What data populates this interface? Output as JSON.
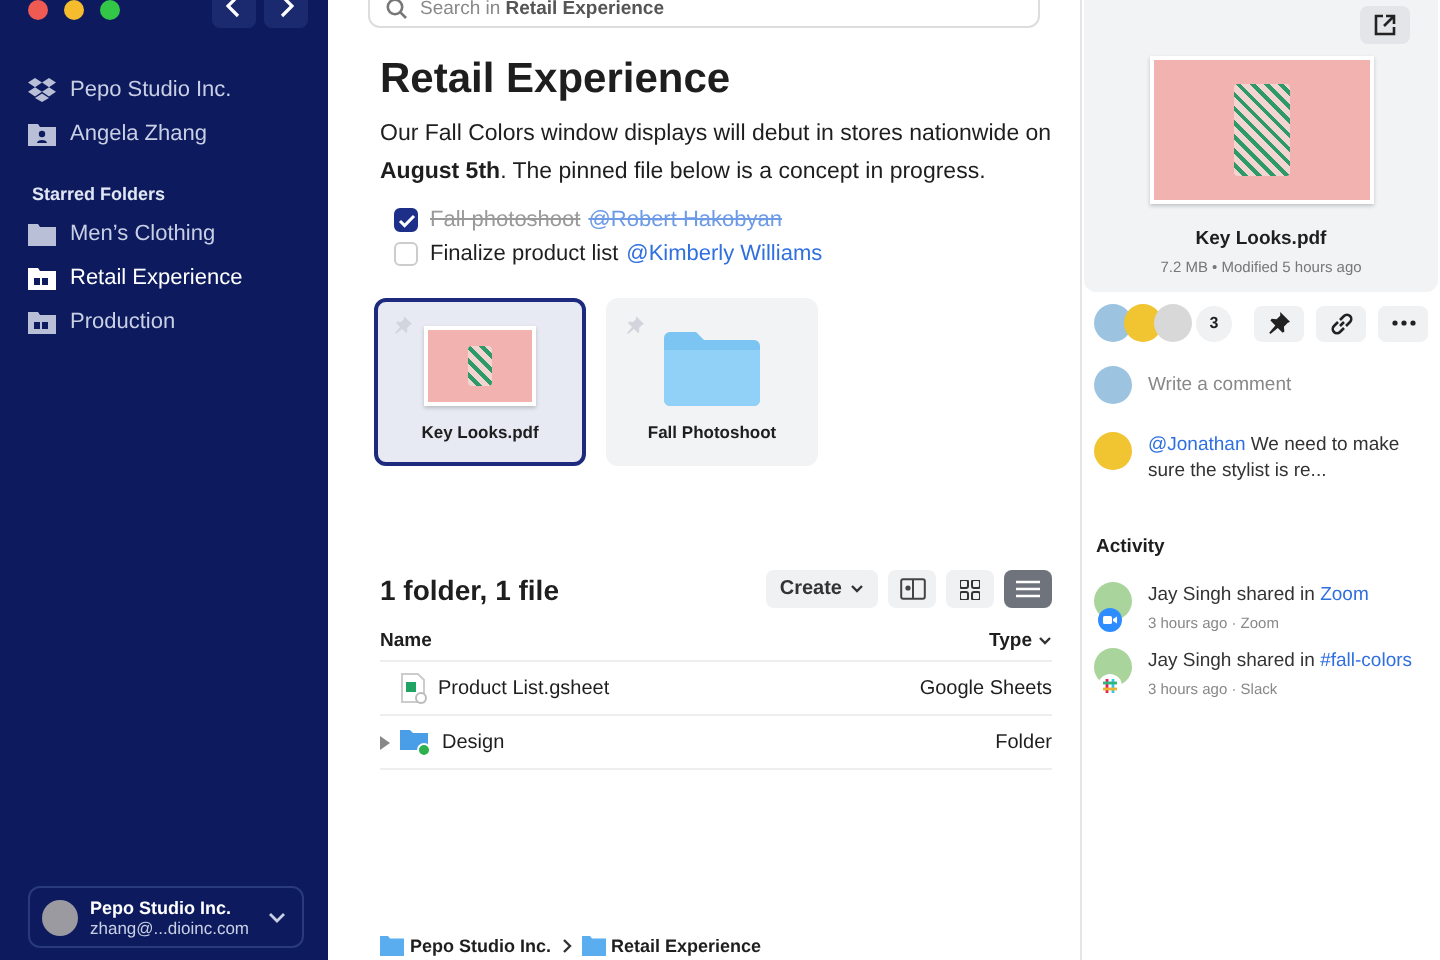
{
  "sidebar": {
    "accounts": [
      {
        "kind": "team",
        "label": "Pepo Studio Inc."
      },
      {
        "kind": "personal",
        "label": "Angela Zhang"
      }
    ],
    "starred_heading": "Starred Folders",
    "folders": [
      {
        "label": "Men’s Clothing",
        "kind": "plain",
        "selected": false
      },
      {
        "label": "Retail Experience",
        "kind": "shared",
        "selected": true
      },
      {
        "label": "Production",
        "kind": "shared",
        "selected": false
      }
    ],
    "account_card": {
      "name": "Pepo Studio Inc.",
      "email": "zhang@...dioinc.com"
    }
  },
  "search": {
    "placeholder": "Search in **Retail Experience**"
  },
  "page": {
    "title": "Retail Experience",
    "description": "Our Fall Colors window displays will debut in stores nationwide on **August 5th**. The pinned file below is a concept in progress.",
    "tasks": [
      {
        "text": "Fall photoshoot",
        "mention": "@Robert Hakobyan",
        "checked": true
      },
      {
        "text": "Finalize product list",
        "mention": "@Kimberly Williams",
        "checked": false
      }
    ],
    "pinned": [
      {
        "kind": "image",
        "label": "Key Looks.pdf",
        "selected": true
      },
      {
        "kind": "folder",
        "label": "Fall Photoshoot",
        "selected": false
      }
    ]
  },
  "listing": {
    "summary": "1 folder, 1 file",
    "create_button": "Create",
    "views": [
      {
        "kind": "preview",
        "selected": false
      },
      {
        "kind": "grid",
        "selected": false
      },
      {
        "kind": "list",
        "selected": true
      }
    ],
    "columns": [
      "Name",
      "Type"
    ],
    "rows": [
      {
        "kind": "sheet",
        "name": "Product List.gsheet",
        "type": "Google Sheets"
      },
      {
        "kind": "folder",
        "name": "Design",
        "type": "Folder"
      }
    ]
  },
  "breadcrumb": [
    "Pepo Studio Inc.",
    "Retail Experience"
  ],
  "details": {
    "file_name": "Key Looks.pdf",
    "meta": "7.2 MB • Modified 5 hours ago",
    "member_count": "3",
    "comment_placeholder": "Write a comment",
    "comment": {
      "mention": "@Jonathan",
      "text": "We need to make sure the stylist is re..."
    },
    "activity_heading": "Activity",
    "activity": [
      {
        "kind": "zoom",
        "text": "Jay Singh shared in",
        "link": "Zoom",
        "meta": "3 hours ago · Zoom"
      },
      {
        "kind": "slack",
        "text": "Jay Singh shared in",
        "link": "#fall-colors",
        "meta": "3 hours ago · Slack"
      }
    ]
  }
}
